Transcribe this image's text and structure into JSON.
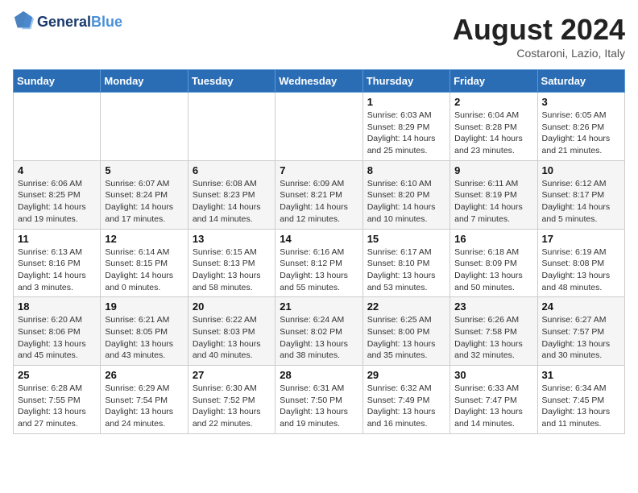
{
  "header": {
    "logo_line1": "General",
    "logo_line2": "Blue",
    "month": "August 2024",
    "location": "Costaroni, Lazio, Italy"
  },
  "days_of_week": [
    "Sunday",
    "Monday",
    "Tuesday",
    "Wednesday",
    "Thursday",
    "Friday",
    "Saturday"
  ],
  "weeks": [
    [
      {
        "day": "",
        "info": ""
      },
      {
        "day": "",
        "info": ""
      },
      {
        "day": "",
        "info": ""
      },
      {
        "day": "",
        "info": ""
      },
      {
        "day": "1",
        "info": "Sunrise: 6:03 AM\nSunset: 8:29 PM\nDaylight: 14 hours\nand 25 minutes."
      },
      {
        "day": "2",
        "info": "Sunrise: 6:04 AM\nSunset: 8:28 PM\nDaylight: 14 hours\nand 23 minutes."
      },
      {
        "day": "3",
        "info": "Sunrise: 6:05 AM\nSunset: 8:26 PM\nDaylight: 14 hours\nand 21 minutes."
      }
    ],
    [
      {
        "day": "4",
        "info": "Sunrise: 6:06 AM\nSunset: 8:25 PM\nDaylight: 14 hours\nand 19 minutes."
      },
      {
        "day": "5",
        "info": "Sunrise: 6:07 AM\nSunset: 8:24 PM\nDaylight: 14 hours\nand 17 minutes."
      },
      {
        "day": "6",
        "info": "Sunrise: 6:08 AM\nSunset: 8:23 PM\nDaylight: 14 hours\nand 14 minutes."
      },
      {
        "day": "7",
        "info": "Sunrise: 6:09 AM\nSunset: 8:21 PM\nDaylight: 14 hours\nand 12 minutes."
      },
      {
        "day": "8",
        "info": "Sunrise: 6:10 AM\nSunset: 8:20 PM\nDaylight: 14 hours\nand 10 minutes."
      },
      {
        "day": "9",
        "info": "Sunrise: 6:11 AM\nSunset: 8:19 PM\nDaylight: 14 hours\nand 7 minutes."
      },
      {
        "day": "10",
        "info": "Sunrise: 6:12 AM\nSunset: 8:17 PM\nDaylight: 14 hours\nand 5 minutes."
      }
    ],
    [
      {
        "day": "11",
        "info": "Sunrise: 6:13 AM\nSunset: 8:16 PM\nDaylight: 14 hours\nand 3 minutes."
      },
      {
        "day": "12",
        "info": "Sunrise: 6:14 AM\nSunset: 8:15 PM\nDaylight: 14 hours\nand 0 minutes."
      },
      {
        "day": "13",
        "info": "Sunrise: 6:15 AM\nSunset: 8:13 PM\nDaylight: 13 hours\nand 58 minutes."
      },
      {
        "day": "14",
        "info": "Sunrise: 6:16 AM\nSunset: 8:12 PM\nDaylight: 13 hours\nand 55 minutes."
      },
      {
        "day": "15",
        "info": "Sunrise: 6:17 AM\nSunset: 8:10 PM\nDaylight: 13 hours\nand 53 minutes."
      },
      {
        "day": "16",
        "info": "Sunrise: 6:18 AM\nSunset: 8:09 PM\nDaylight: 13 hours\nand 50 minutes."
      },
      {
        "day": "17",
        "info": "Sunrise: 6:19 AM\nSunset: 8:08 PM\nDaylight: 13 hours\nand 48 minutes."
      }
    ],
    [
      {
        "day": "18",
        "info": "Sunrise: 6:20 AM\nSunset: 8:06 PM\nDaylight: 13 hours\nand 45 minutes."
      },
      {
        "day": "19",
        "info": "Sunrise: 6:21 AM\nSunset: 8:05 PM\nDaylight: 13 hours\nand 43 minutes."
      },
      {
        "day": "20",
        "info": "Sunrise: 6:22 AM\nSunset: 8:03 PM\nDaylight: 13 hours\nand 40 minutes."
      },
      {
        "day": "21",
        "info": "Sunrise: 6:24 AM\nSunset: 8:02 PM\nDaylight: 13 hours\nand 38 minutes."
      },
      {
        "day": "22",
        "info": "Sunrise: 6:25 AM\nSunset: 8:00 PM\nDaylight: 13 hours\nand 35 minutes."
      },
      {
        "day": "23",
        "info": "Sunrise: 6:26 AM\nSunset: 7:58 PM\nDaylight: 13 hours\nand 32 minutes."
      },
      {
        "day": "24",
        "info": "Sunrise: 6:27 AM\nSunset: 7:57 PM\nDaylight: 13 hours\nand 30 minutes."
      }
    ],
    [
      {
        "day": "25",
        "info": "Sunrise: 6:28 AM\nSunset: 7:55 PM\nDaylight: 13 hours\nand 27 minutes."
      },
      {
        "day": "26",
        "info": "Sunrise: 6:29 AM\nSunset: 7:54 PM\nDaylight: 13 hours\nand 24 minutes."
      },
      {
        "day": "27",
        "info": "Sunrise: 6:30 AM\nSunset: 7:52 PM\nDaylight: 13 hours\nand 22 minutes."
      },
      {
        "day": "28",
        "info": "Sunrise: 6:31 AM\nSunset: 7:50 PM\nDaylight: 13 hours\nand 19 minutes."
      },
      {
        "day": "29",
        "info": "Sunrise: 6:32 AM\nSunset: 7:49 PM\nDaylight: 13 hours\nand 16 minutes."
      },
      {
        "day": "30",
        "info": "Sunrise: 6:33 AM\nSunset: 7:47 PM\nDaylight: 13 hours\nand 14 minutes."
      },
      {
        "day": "31",
        "info": "Sunrise: 6:34 AM\nSunset: 7:45 PM\nDaylight: 13 hours\nand 11 minutes."
      }
    ]
  ]
}
